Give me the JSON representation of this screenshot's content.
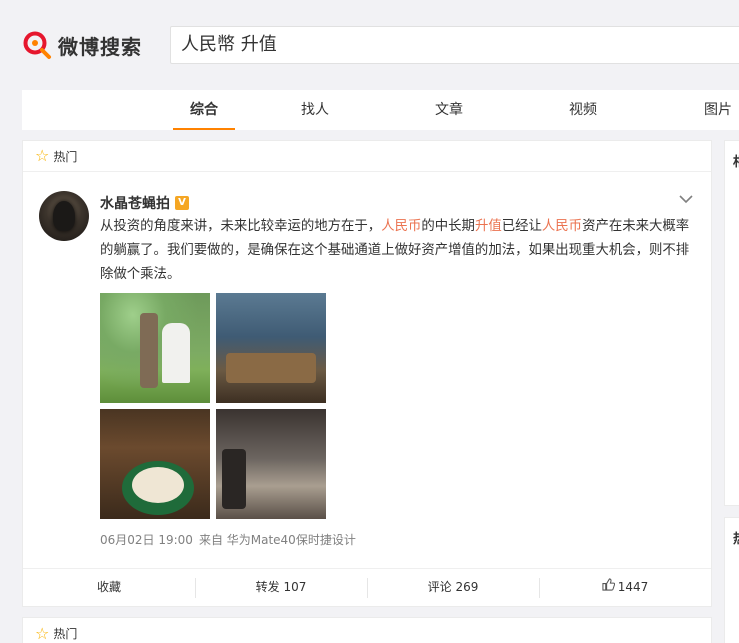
{
  "header": {
    "logo_text": "微博搜索",
    "search_query": "人民幣 升值"
  },
  "tabs": [
    {
      "label": "综合",
      "active": true
    },
    {
      "label": "找人",
      "active": false
    },
    {
      "label": "文章",
      "active": false
    },
    {
      "label": "视频",
      "active": false
    },
    {
      "label": "图片",
      "active": false
    }
  ],
  "feed": {
    "section_label": "热门",
    "post": {
      "username": "水晶苍蝇拍",
      "verified_badge": "V",
      "text_parts": [
        {
          "text": "从投资的角度来讲，未来比较幸运的地方在于，",
          "highlight": false
        },
        {
          "text": "人民币",
          "highlight": true
        },
        {
          "text": "的中长期",
          "highlight": false
        },
        {
          "text": "升值",
          "highlight": true
        },
        {
          "text": "已经让",
          "highlight": false
        },
        {
          "text": "人民币",
          "highlight": true
        },
        {
          "text": "资产在未来大概率的躺赢了。我们要做的，是确保在这个基础通道上做好资产增值的加法，如果出现重大机会，则不排除做个乘法。",
          "highlight": false
        }
      ],
      "timestamp": "06月02日 19:00",
      "source": "来自 华为Mate40保时捷设计",
      "actions": {
        "favorite": "收藏",
        "repost": "转发 107",
        "comment": "评论 269",
        "like": "1447"
      }
    },
    "second_section_label": "热门"
  },
  "sidebar": {
    "panel1_title_partial": "相",
    "panel2_title_partial": "热"
  },
  "colors": {
    "highlight": "#eb7350",
    "tab_underline": "#ff8200",
    "logo_accent": "#e6162d"
  }
}
